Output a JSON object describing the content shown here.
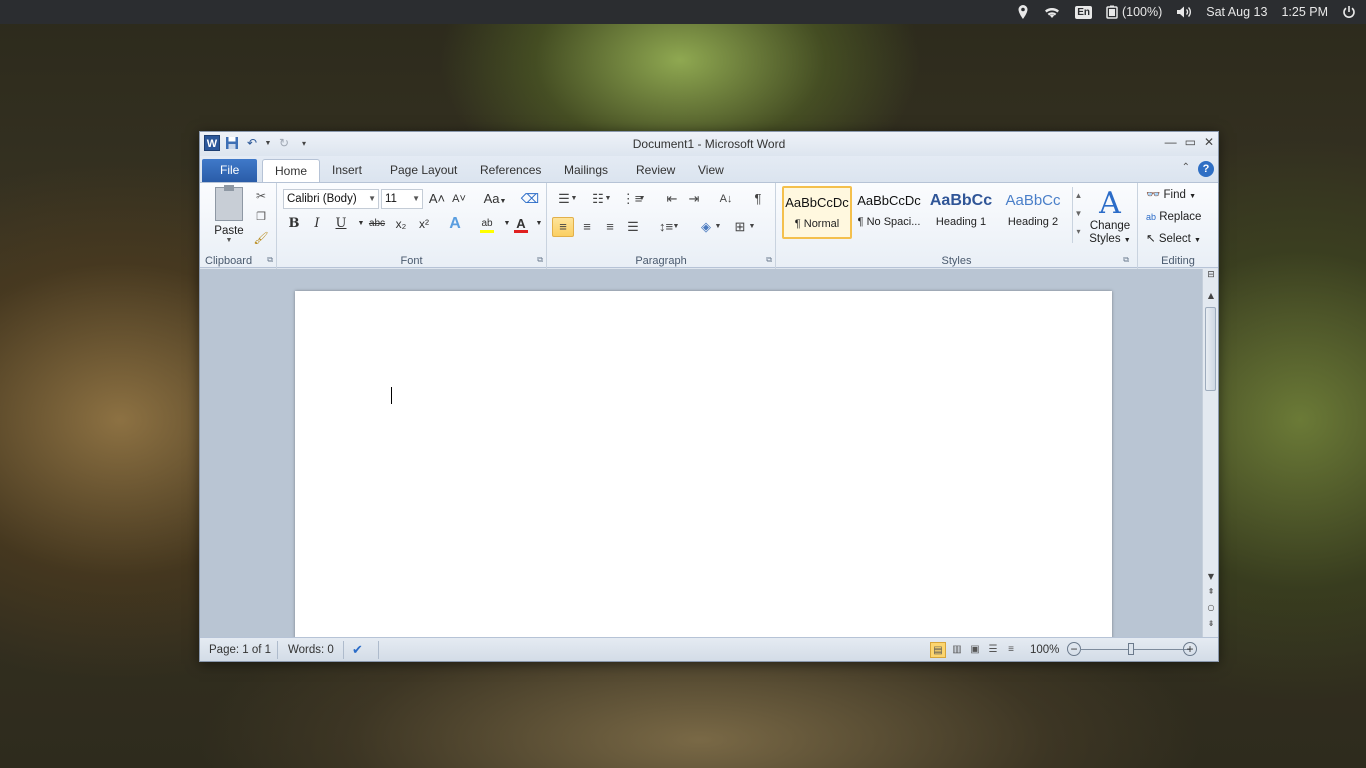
{
  "system_bar": {
    "keyboard_layout": "En",
    "battery": "(100%)",
    "date": "Sat Aug 13",
    "time": "1:25 PM",
    "icons": [
      "location-icon",
      "wifi-icon",
      "keyboard-icon",
      "battery-icon",
      "volume-icon",
      "power-icon"
    ]
  },
  "window": {
    "title": "Document1  -  Microsoft Word",
    "app_logo": "W"
  },
  "tabs": {
    "file": "File",
    "home": "Home",
    "insert": "Insert",
    "page_layout": "Page Layout",
    "references": "References",
    "mailings": "Mailings",
    "review": "Review",
    "view": "View",
    "help": "?"
  },
  "ribbon": {
    "clipboard": {
      "label": "Clipboard",
      "paste": "Paste"
    },
    "font": {
      "label": "Font",
      "font_name": "Calibri (Body)",
      "font_size": "11",
      "change_case": "Aa",
      "bold": "B",
      "italic": "I",
      "underline": "U",
      "strike": "abc",
      "subscript": "x₂",
      "superscript": "x²",
      "grow": "A˄",
      "shrink": "A˅"
    },
    "paragraph": {
      "label": "Paragraph",
      "show_marks": "¶"
    },
    "styles": {
      "label": "Styles",
      "items": [
        {
          "sample": "AaBbCcDc",
          "name": "¶ Normal"
        },
        {
          "sample": "AaBbCcDc",
          "name": "¶ No Spaci..."
        },
        {
          "sample": "AaBbCc",
          "name": "Heading 1"
        },
        {
          "sample": "AaBbCc",
          "name": "Heading 2"
        }
      ],
      "change_styles_line1": "Change",
      "change_styles_line2": "Styles"
    },
    "editing": {
      "label": "Editing",
      "find": "Find",
      "replace": "Replace",
      "select": "Select"
    }
  },
  "statusbar": {
    "page": "Page: 1 of 1",
    "words": "Words: 0",
    "zoom": "100%",
    "zoom_level": 1.0
  },
  "colors": {
    "accent": "#2b579a",
    "selection": "#fbcf62",
    "highlight": "#ffff00",
    "font_color": "#e02020"
  }
}
